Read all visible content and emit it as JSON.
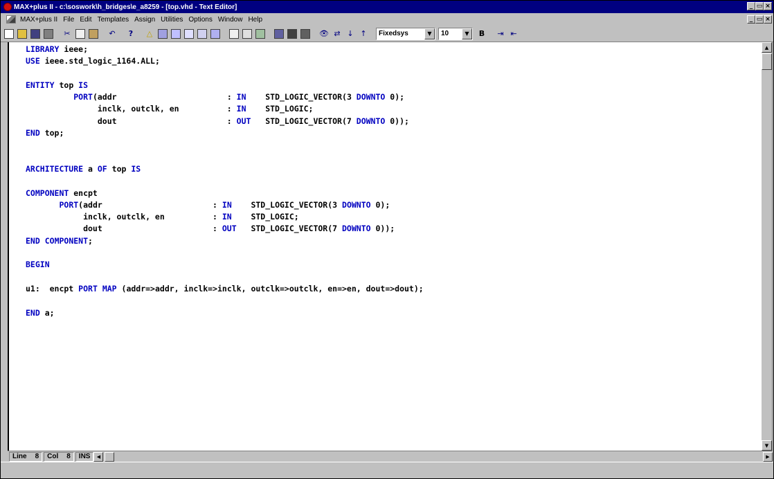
{
  "window": {
    "title": "MAX+plus II - c:\\soswork\\h_bridges\\e_a8259 - [top.vhd - Text Editor]",
    "caption_buttons": [
      "_",
      " ",
      "×"
    ],
    "accent": "#000080"
  },
  "menu": {
    "items": [
      {
        "label": "MAX+plus II"
      },
      {
        "label": "File"
      },
      {
        "label": "Edit"
      },
      {
        "label": "Templates"
      },
      {
        "label": "Assign"
      },
      {
        "label": "Utilities"
      },
      {
        "label": "Options"
      },
      {
        "label": "Window"
      },
      {
        "label": "Help"
      }
    ]
  },
  "toolbar": {
    "font_value": "Fixedsys",
    "size_value": "10",
    "icons": [
      "new-file-icon",
      "open-icon",
      "save-icon",
      "print-icon",
      "cut-icon",
      "copy-icon",
      "paste-icon",
      "undo-icon",
      "help-pointer-icon",
      "compile-warning-icon",
      "hierarchy-icon",
      "floorplan-icon",
      "graphic-editor-icon",
      "symbol-editor-icon",
      "text-editor-icon",
      "waveform-editor-icon",
      "compiler-icon",
      "simulator-icon",
      "timing-analyzer-icon",
      "programmer-icon",
      "open-project-icon",
      "save-check-icon",
      "save-compile-icon",
      "find-text-icon",
      "find-replace-icon",
      "find-next-icon",
      "find-prev-icon",
      "bold-icon",
      "indent-icon",
      "outdent-icon"
    ]
  },
  "code": [
    "LIBRARY ieee;",
    "USE ieee.std_logic_1164.ALL;",
    "",
    "ENTITY top IS",
    "          PORT(addr                       : IN    STD_LOGIC_VECTOR(3 DOWNTO 0);",
    "               inclk, outclk, en          : IN    STD_LOGIC;",
    "               dout                       : OUT   STD_LOGIC_VECTOR(7 DOWNTO 0));",
    "END top;",
    "",
    "",
    "ARCHITECTURE a OF top IS",
    "",
    "COMPONENT encpt",
    "       PORT(addr                       : IN    STD_LOGIC_VECTOR(3 DOWNTO 0);",
    "            inclk, outclk, en          : IN    STD_LOGIC;",
    "            dout                       : OUT   STD_LOGIC_VECTOR(7 DOWNTO 0));",
    "END COMPONENT;",
    "",
    "BEGIN",
    "",
    "u1:  encpt PORT MAP (addr=>addr, inclk=>inclk, outclk=>outclk, en=>en, dout=>dout);",
    "",
    "END a;"
  ],
  "keywords": [
    "LIBRARY",
    "USE",
    "ENTITY",
    "IS",
    "PORT",
    "IN",
    "OUT",
    "DOWNTO",
    "END",
    "ARCHITECTURE",
    "OF",
    "COMPONENT",
    "BEGIN",
    "MAP"
  ],
  "status": {
    "line_label": "Line",
    "line_value": "8",
    "col_label": "Col",
    "col_value": "8",
    "mode": "INS"
  }
}
